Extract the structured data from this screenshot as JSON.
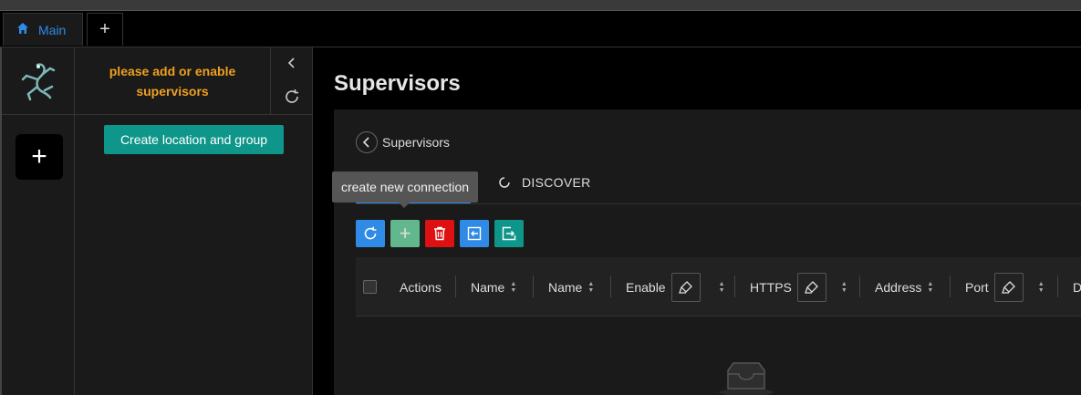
{
  "tabs": {
    "main_label": "Main",
    "add_label": "+"
  },
  "panel": {
    "message": "please add or enable supervisors",
    "create_button": "Create location and group"
  },
  "rail": {
    "add_label": "+"
  },
  "main": {
    "title": "Supervisors",
    "breadcrumb": "Supervisors",
    "discover_label": "DISCOVER",
    "tooltip": "create new connection",
    "toolbar": {
      "add_label": "+"
    },
    "table": {
      "columns": [
        "Actions",
        "Name",
        "Name",
        "Enable",
        "HTTPS",
        "Address",
        "Port",
        "D"
      ]
    }
  },
  "colors": {
    "accent_blue": "#2f8be6",
    "teal": "#0f968a",
    "warning_orange": "#f0a020",
    "danger_red": "#dd1111"
  }
}
